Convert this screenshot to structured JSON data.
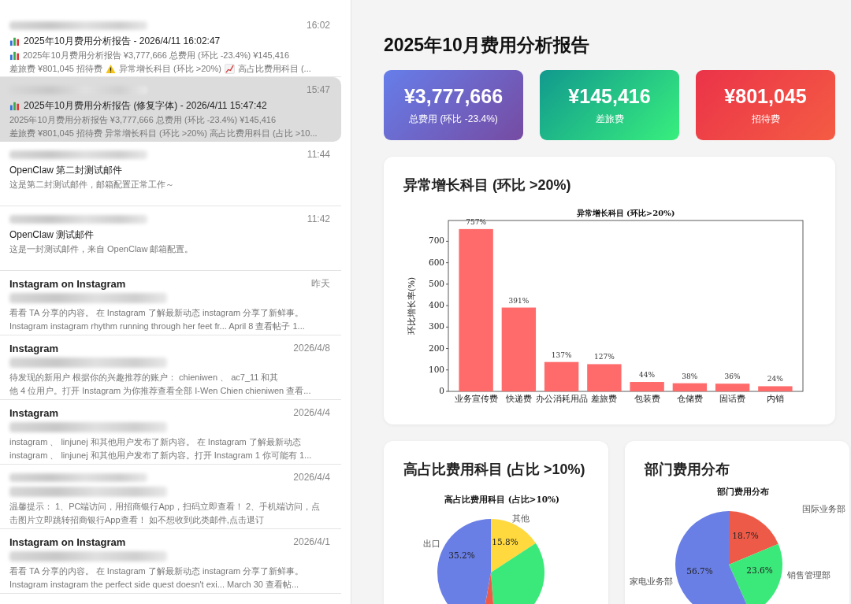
{
  "mail_list": [
    {
      "sender_hidden": true,
      "time": "16:02",
      "subject_hidden": false,
      "subject_mark": true,
      "subject": "2025年10月费用分析报告 - 2026/4/11 16:02:47",
      "selected": false,
      "preview": [
        [
          {
            "kind": "chart_mark"
          },
          {
            "kind": "text",
            "text": "2025年10月费用分析报告 ¥3,777,666 总费用 (环比 -23.4%) ¥145,416"
          }
        ],
        [
          {
            "kind": "text",
            "text": "差旅费 ¥801,045 招待费"
          },
          {
            "kind": "warn_mark"
          },
          {
            "kind": "text",
            "text": "异常增长科目 (环比 >20%)"
          },
          {
            "kind": "trend_mark"
          },
          {
            "kind": "text",
            "text": "高占比费用科目 (..."
          }
        ]
      ]
    },
    {
      "sender_hidden": true,
      "time": "15:47",
      "subject_hidden": false,
      "subject_mark": true,
      "subject": "2025年10月费用分析报告 (修复字体) - 2026/4/11 15:47:42",
      "selected": true,
      "preview": [
        [
          {
            "kind": "text",
            "text": "2025年10月费用分析报告 ¥3,777,666 总费用 (环比 -23.4%) ¥145,416"
          }
        ],
        [
          {
            "kind": "text",
            "text": "差旅费 ¥801,045 招待费 异常增长科目 (环比 >20%) 高占比费用科目 (占比 >10..."
          }
        ]
      ]
    },
    {
      "sender_hidden": true,
      "time": "11:44",
      "subject_hidden": false,
      "subject_mark": false,
      "subject": "OpenClaw 第二封测试邮件",
      "selected": false,
      "preview": [
        [
          {
            "kind": "text",
            "text": "这是第二封测试邮件，邮箱配置正常工作～"
          }
        ]
      ]
    },
    {
      "sender_hidden": true,
      "time": "11:42",
      "subject_hidden": false,
      "subject_mark": false,
      "subject": "OpenClaw 测试邮件",
      "selected": false,
      "preview": [
        [
          {
            "kind": "text",
            "text": "这是一封测试邮件，来自 OpenClaw 邮箱配置。"
          }
        ]
      ]
    },
    {
      "sender_hidden": false,
      "sender": "Instagram on Instagram",
      "time": "昨天",
      "subject_hidden": true,
      "selected": false,
      "preview": [
        [
          {
            "kind": "text",
            "text": "看看 TA 分享的内容。 在 Instagram 了解最新动态 instagram 分享了新鲜事。"
          }
        ],
        [
          {
            "kind": "text",
            "text": "Instagram instagram rhythm running through her feet fr... April 8 查看帖子 1..."
          }
        ]
      ]
    },
    {
      "sender_hidden": false,
      "sender": "Instagram",
      "time": "2026/4/8",
      "subject_hidden": true,
      "selected": false,
      "preview": [
        [
          {
            "kind": "text",
            "text": "待发现的新用户 根据你的兴趣推荐的账户： chieniwen 、 ac7_11 和其"
          }
        ],
        [
          {
            "kind": "text",
            "text": "他 4 位用户。打开 Instagram 为你推荐查看全部 I-Wen Chien chieniwen 查看..."
          }
        ]
      ]
    },
    {
      "sender_hidden": false,
      "sender": "Instagram",
      "time": "2026/4/4",
      "subject_hidden": true,
      "selected": false,
      "preview": [
        [
          {
            "kind": "text",
            "text": "instagram 、 linjunej 和其他用户发布了新内容。 在 Instagram 了解最新动态"
          }
        ],
        [
          {
            "kind": "text",
            "text": "instagram 、 linjunej 和其他用户发布了新内容。打开 Instagram 1 你可能有 1..."
          }
        ]
      ]
    },
    {
      "sender_hidden": true,
      "time": "2026/4/4",
      "subject_hidden": true,
      "selected": false,
      "preview": [
        [
          {
            "kind": "text",
            "text": "温馨提示： 1、PC端访问，用招商银行App，扫码立即查看！ 2、手机端访问，点"
          }
        ],
        [
          {
            "kind": "text",
            "text": "击图片立即跳转招商银行App查看！ 如不想收到此类邮件,点击退订"
          }
        ]
      ]
    },
    {
      "sender_hidden": false,
      "sender": "Instagram on Instagram",
      "time": "2026/4/1",
      "subject_hidden": true,
      "selected": false,
      "preview": [
        [
          {
            "kind": "text",
            "text": "看看 TA 分享的内容。 在 Instagram 了解最新动态 instagram 分享了新鲜事。"
          }
        ],
        [
          {
            "kind": "text",
            "text": "Instagram instagram the perfect side quest doesn't exi... March 30 查看帖..."
          }
        ]
      ]
    }
  ],
  "report": {
    "title": "2025年10月费用分析报告",
    "stat_cards": [
      {
        "value": "¥3,777,666",
        "label": "总费用 (环比 -23.4%)",
        "kind": "purple"
      },
      {
        "value": "¥145,416",
        "label": "差旅费",
        "kind": "green"
      },
      {
        "value": "¥801,045",
        "label": "招待费",
        "kind": "red"
      }
    ],
    "growth_section": {
      "heading": "异常增长科目 (环比 >20%)",
      "chart_data": {
        "type": "bar",
        "title": "异常增长科目 (环比>20%)",
        "ylabel": "环比增长率(%)",
        "categories": [
          "业务宣传费",
          "快递费",
          "办公消耗用品",
          "差旅费",
          "包装费",
          "仓储费",
          "固话费",
          "内销"
        ],
        "series": [
          {
            "color": "#ff6b6b",
            "values": [
              757,
              391,
              137,
              127,
              44,
              38,
              36,
              24
            ]
          }
        ],
        "ylim": [
          0,
          797
        ],
        "yticks": [
          0,
          100,
          200,
          300,
          400,
          500,
          600,
          700
        ],
        "value_labels": [
          "757%",
          "391%",
          "137%",
          "127%",
          "44%",
          "38%",
          "36%",
          "24%"
        ]
      }
    },
    "share_section": {
      "heading": "高占比费用科目 (占比 >10%)",
      "pie_title": "高占比费用科目 (占比>10%)",
      "pie_labels": [
        {
          "text": "其他",
          "kind": "outer"
        },
        {
          "text": "出口",
          "kind": "outer"
        },
        {
          "text": "15.8%",
          "kind": "inner"
        },
        {
          "text": "35.2%",
          "kind": "inner"
        }
      ]
    },
    "dept_section": {
      "heading": "部门费用分布",
      "pie_title": "部门费用分布",
      "pie_labels": [
        {
          "text": "国际业务部",
          "kind": "outer"
        },
        {
          "text": "销售管理部",
          "kind": "outer"
        },
        {
          "text": "家电业务部",
          "kind": "outer"
        },
        {
          "text": "18.7%",
          "kind": "inner"
        },
        {
          "text": "56.7%",
          "kind": "inner"
        },
        {
          "text": "23.6%",
          "kind": "inner"
        }
      ]
    }
  }
}
